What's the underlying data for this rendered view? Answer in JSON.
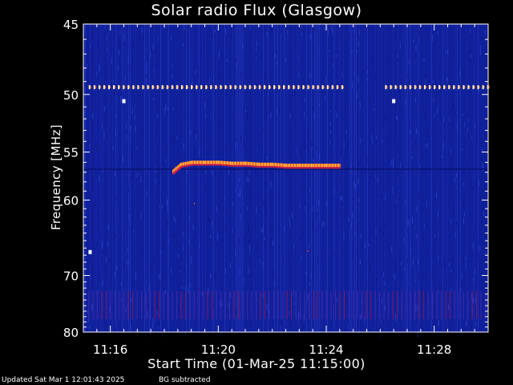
{
  "chart_data": {
    "type": "heatmap",
    "title": "Solar radio Flux (Glasgow)",
    "xlabel": "Start Time (01-Mar-25 11:15:00)",
    "ylabel": "Frequency [MHz]",
    "x_ticks": [
      "11:16",
      "11:20",
      "11:24",
      "11:28"
    ],
    "x_tick_minutes": [
      1,
      5,
      9,
      13
    ],
    "xlim_minutes": [
      0,
      15
    ],
    "y_ticks": [
      45,
      50,
      55,
      60,
      70,
      80
    ],
    "ylim": [
      45,
      80
    ],
    "y_scale": "reciprocal",
    "background_color": "#10209a",
    "burst": {
      "x_minutes": [
        3.3,
        3.6,
        4.0,
        4.5,
        5.0,
        5.5,
        6.0,
        6.5,
        7.0,
        7.5,
        8.0,
        8.5,
        9.0,
        9.5
      ],
      "freq_mhz": [
        56.9,
        56.2,
        56.0,
        56.0,
        56.0,
        56.1,
        56.1,
        56.2,
        56.2,
        56.3,
        56.3,
        56.3,
        56.3,
        56.3
      ]
    },
    "interference_line_mhz": 49.4,
    "interference_gap_minutes": [
      9.7,
      11.1
    ],
    "band_mhz": [
      72.5,
      77.5
    ]
  },
  "footer": {
    "updated": "Updated Sat Mar  1 12:01:43 2025",
    "bg": "BG subtracted"
  }
}
